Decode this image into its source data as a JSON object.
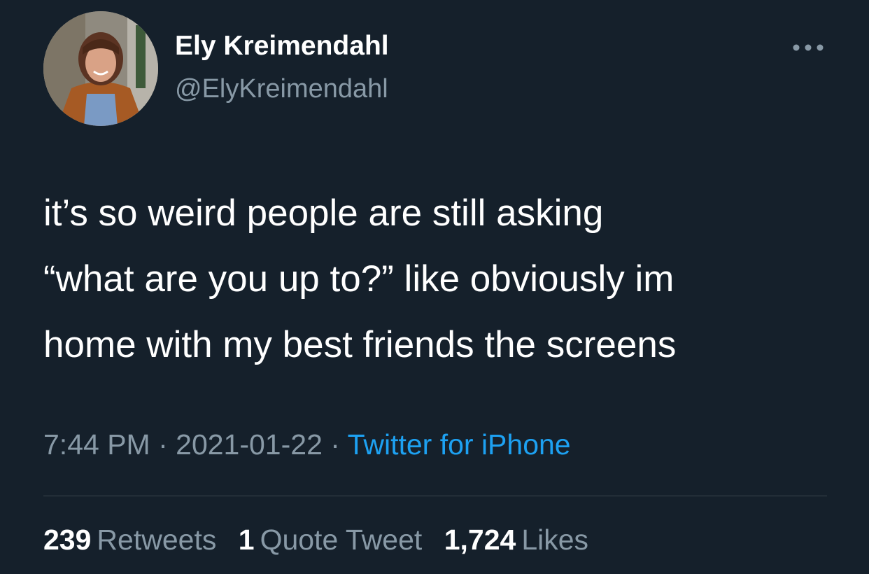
{
  "author": {
    "name": "Ely Kreimendahl",
    "handle": "@ElyKreimendahl",
    "avatar_icon": "profile-photo"
  },
  "more_icon": "more-horizontal-icon",
  "tweet": {
    "lines": [
      "it’s so weird people are still asking",
      "“what are you up to?” like obviously im",
      "home with my best friends the screens"
    ]
  },
  "meta": {
    "time": "7:44 PM",
    "separator1": " · ",
    "date": "2021-01-22",
    "separator2": " · ",
    "source": "Twitter for iPhone"
  },
  "stats": {
    "retweets_count": "239",
    "retweets_label": "Retweets",
    "quotes_count": "1",
    "quotes_label": "Quote Tweet",
    "likes_count": "1,724",
    "likes_label": "Likes"
  },
  "colors": {
    "background": "#15202b",
    "primary_text": "#ffffff",
    "secondary_text": "#8899a6",
    "link": "#1da1f2",
    "divider": "#38444d"
  }
}
